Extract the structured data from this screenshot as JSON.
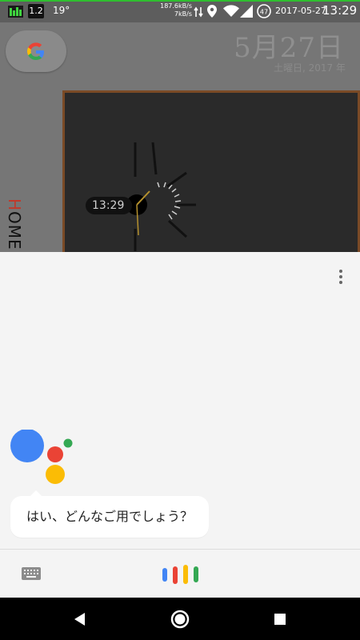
{
  "status_bar": {
    "badge": "1.2",
    "temperature": "19°",
    "rate_up": "187.6kB/s",
    "rate_down": "7kB/s",
    "battery": "47",
    "date": "2017-05-27",
    "time": "13:29",
    "icons": [
      "equalizer-icon",
      "data-transfer-icon",
      "location-icon",
      "wifi-icon",
      "signal-icon",
      "battery-icon"
    ]
  },
  "home": {
    "google_logo": "G",
    "date": "5月27日",
    "weekday": "土曜日, 2017 年",
    "label": "HOME",
    "clock_time": "13:29"
  },
  "assistant": {
    "prompt": "はい、どんなご用でしょう？",
    "colors": {
      "blue": "#4285F4",
      "red": "#EA4335",
      "yellow": "#FBBC05",
      "green": "#34A853"
    }
  },
  "nav": {
    "buttons": [
      "back",
      "home",
      "recents"
    ]
  }
}
